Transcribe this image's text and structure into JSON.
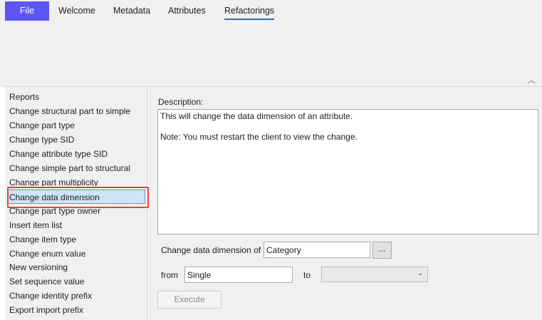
{
  "tabs": {
    "file": "File",
    "welcome": "Welcome",
    "metadata": "Metadata",
    "attributes": "Attributes",
    "refactorings": "Refactorings"
  },
  "refactoring_list": [
    "Reports",
    "Change structural part to simple",
    "Change part type",
    "Change type SID",
    "Change attribute type SID",
    "Change simple part to structural",
    "Change part multiplicity",
    "Change data dimension",
    "Change part type owner",
    "Insert item list",
    "Change item type",
    "Change enum value",
    "New versioning",
    "Set sequence value",
    "Change identity prefix",
    "Export import prefix"
  ],
  "selected_item": "Change data dimension",
  "description": {
    "label": "Description:",
    "line1": "This will change the data dimension of an attribute.",
    "line2": "Note: You must restart the client to view the change."
  },
  "form": {
    "change_label": "Change data dimension of",
    "attribute_value": "Category",
    "browse_label": "...",
    "from_label": "from",
    "from_value": "Single",
    "to_label": "to",
    "to_value": "",
    "execute_label": "Execute"
  },
  "colors": {
    "file_tab": "#5b55f5",
    "selection_bg": "#cde6f7",
    "highlight_border": "#e8423a",
    "active_tab_underline": "#2b6cb0"
  }
}
